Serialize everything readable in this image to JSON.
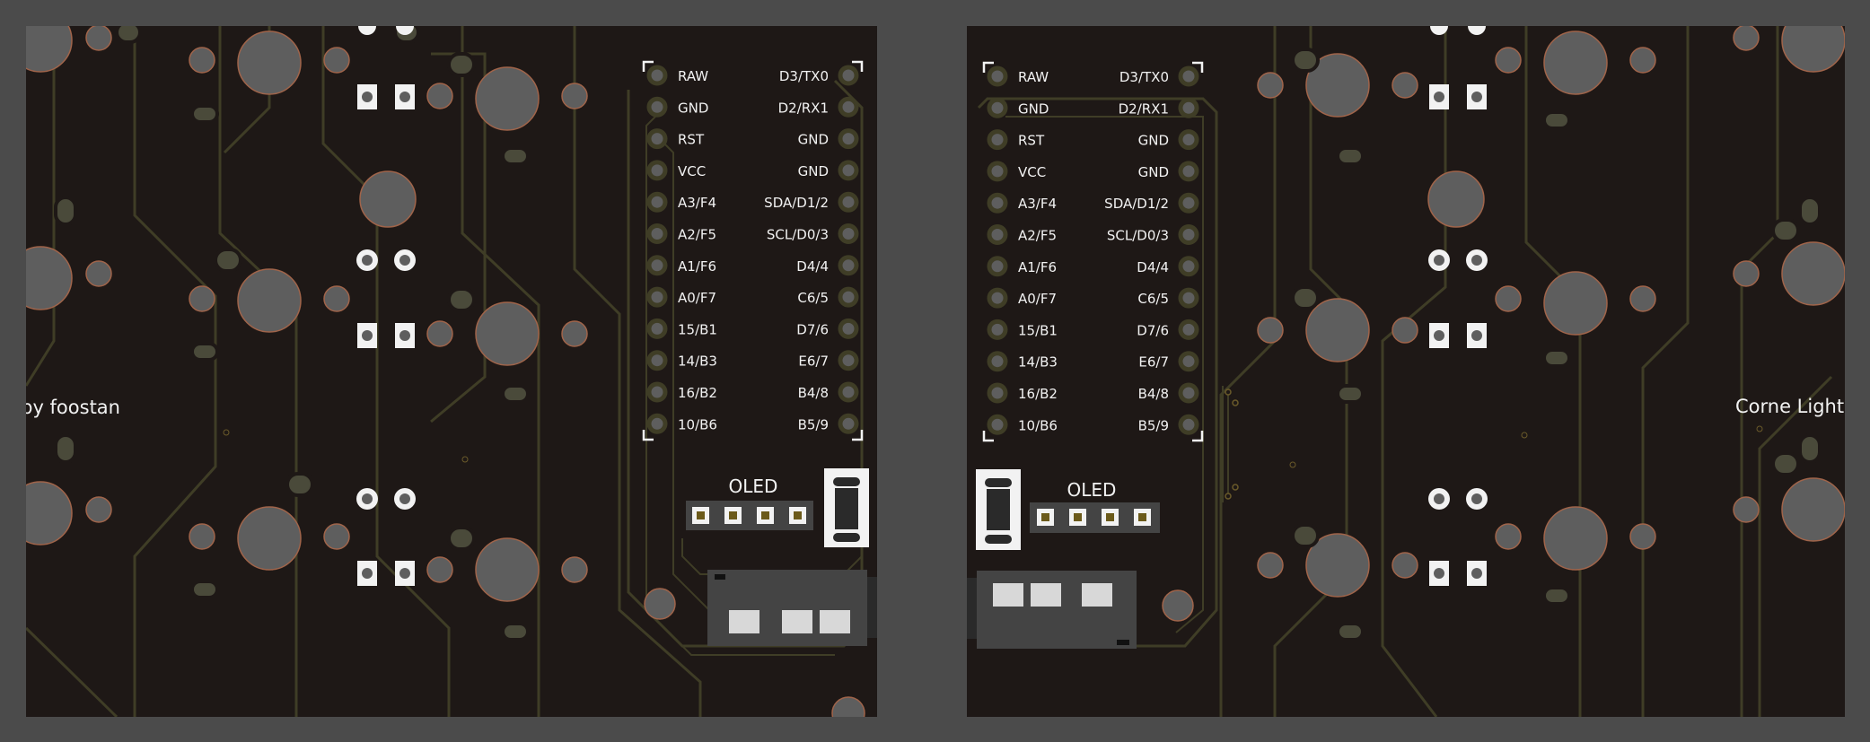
{
  "board": {
    "left_label": "by foostan",
    "right_label": "Corne Light",
    "oled_label": "OLED",
    "pins_left": [
      "RAW",
      "GND",
      "RST",
      "VCC",
      "A3/F4",
      "A2/F5",
      "A1/F6",
      "A0/F7",
      "15/B1",
      "14/B3",
      "16/B2",
      "10/B6"
    ],
    "pins_right": [
      "D3/TX0",
      "D2/RX1",
      "GND",
      "GND",
      "SDA/D1/2",
      "SCL/D0/3",
      "D4/4",
      "C6/5",
      "D7/6",
      "E6/7",
      "B4/8",
      "B5/9"
    ]
  },
  "colors": {
    "background": "#4b4b4b",
    "board": "#1e1816",
    "trace": "#3f3d26",
    "silkscreen": "#f2f2f2",
    "copper": "#b06a4a",
    "hole": "#5e5e5e"
  }
}
